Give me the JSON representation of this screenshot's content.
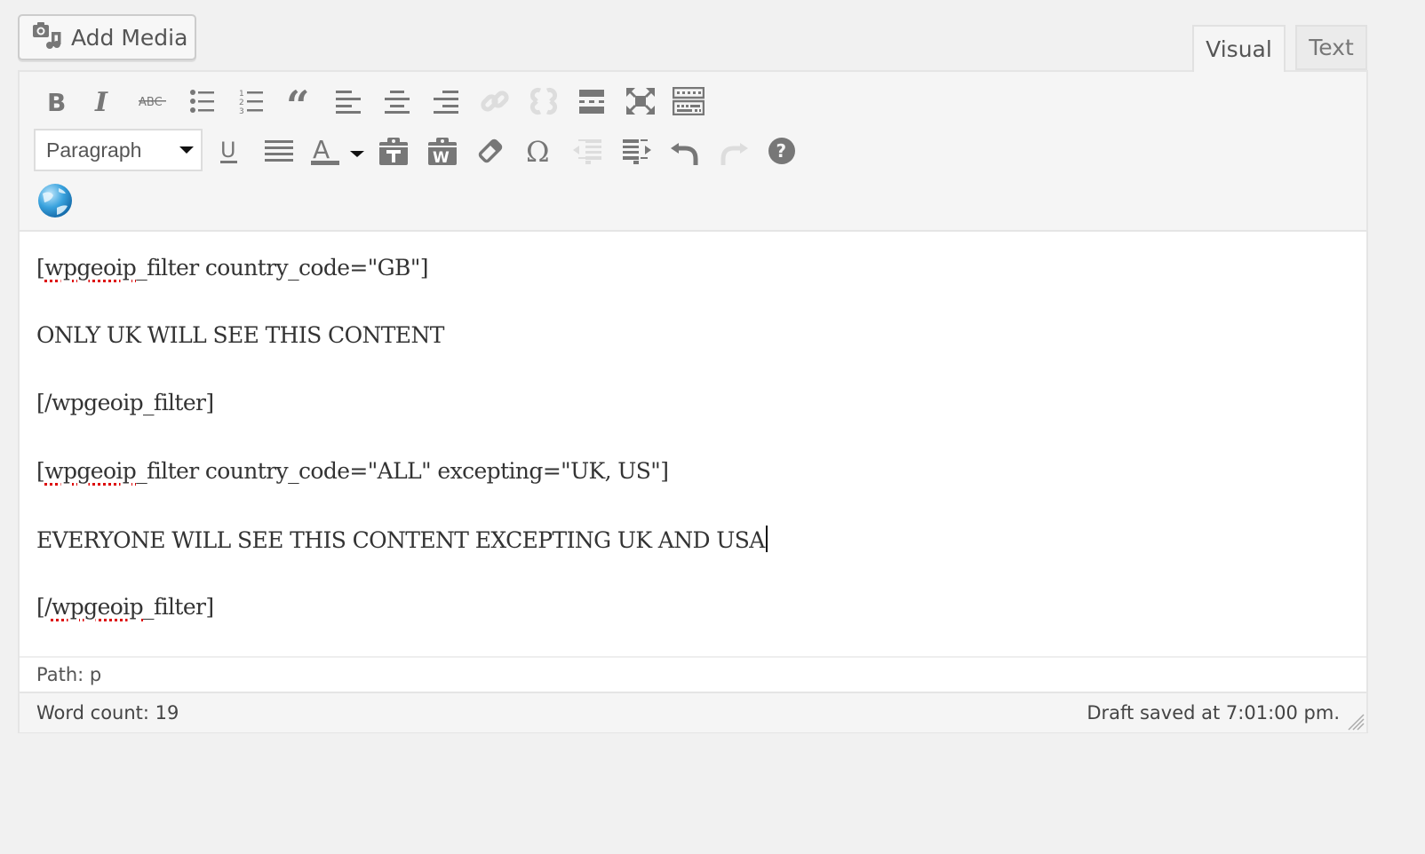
{
  "media": {
    "add_media_label": "Add Media"
  },
  "tabs": [
    {
      "label": "Visual",
      "active": true
    },
    {
      "label": "Text",
      "active": false
    }
  ],
  "toolbar": {
    "row1": [
      {
        "name": "bold",
        "icon": "bold-icon"
      },
      {
        "name": "italic",
        "icon": "italic-icon"
      },
      {
        "name": "strikethrough",
        "icon": "strikethrough-icon"
      },
      {
        "name": "bulleted-list",
        "icon": "bulleted-list-icon"
      },
      {
        "name": "numbered-list",
        "icon": "numbered-list-icon"
      },
      {
        "name": "blockquote",
        "icon": "blockquote-icon"
      },
      {
        "name": "align-left",
        "icon": "align-left-icon"
      },
      {
        "name": "align-center",
        "icon": "align-center-icon"
      },
      {
        "name": "align-right",
        "icon": "align-right-icon"
      },
      {
        "name": "insert-link",
        "icon": "link-icon",
        "disabled": true
      },
      {
        "name": "remove-link",
        "icon": "unlink-icon",
        "disabled": true
      },
      {
        "name": "read-more",
        "icon": "read-more-icon"
      },
      {
        "name": "distraction-free",
        "icon": "fullscreen-icon"
      },
      {
        "name": "toolbar-toggle",
        "icon": "keyboard-icon"
      }
    ],
    "format_select": {
      "value": "Paragraph"
    },
    "row2": [
      {
        "name": "underline",
        "icon": "underline-icon"
      },
      {
        "name": "justify",
        "icon": "justify-icon"
      },
      {
        "name": "text-color",
        "icon": "text-color-icon"
      },
      {
        "name": "paste-as-text",
        "icon": "paste-text-icon"
      },
      {
        "name": "paste-from-word",
        "icon": "paste-word-icon"
      },
      {
        "name": "clear-formatting",
        "icon": "eraser-icon"
      },
      {
        "name": "special-character",
        "icon": "omega-icon"
      },
      {
        "name": "decrease-indent",
        "icon": "outdent-icon",
        "disabled": true
      },
      {
        "name": "increase-indent",
        "icon": "indent-icon"
      },
      {
        "name": "undo",
        "icon": "undo-icon"
      },
      {
        "name": "redo",
        "icon": "redo-icon",
        "disabled": true
      },
      {
        "name": "help",
        "icon": "help-icon"
      }
    ],
    "row3": [
      {
        "name": "wpgeoip",
        "icon": "globe-icon"
      }
    ]
  },
  "content": {
    "lines": [
      {
        "misspelled": "wpgeoip",
        "prefix": "[",
        "rest": "_filter country_code=\"GB\"]"
      },
      {
        "text": "ONLY UK WILL SEE THIS CONTENT"
      },
      {
        "text": "[/wpgeoip_filter]"
      },
      {
        "misspelled": "wpgeoip",
        "prefix": "[",
        "rest": "_filter country_code=\"ALL\" excepting=\"UK, US\"]"
      },
      {
        "text": "EVERYONE WILL SEE THIS CONTENT EXCEPTING UK AND USA"
      },
      {
        "misspelled": "wpgeoip",
        "prefix": "[/",
        "rest": "_filter]"
      }
    ]
  },
  "path": {
    "text": "Path: p"
  },
  "status": {
    "word_count": "Word count: 19",
    "draft_saved": "Draft saved at 7:01:00 pm."
  },
  "colors": {
    "icon": "#777777",
    "icon_disabled": "#dddddd",
    "text": "#333333"
  }
}
